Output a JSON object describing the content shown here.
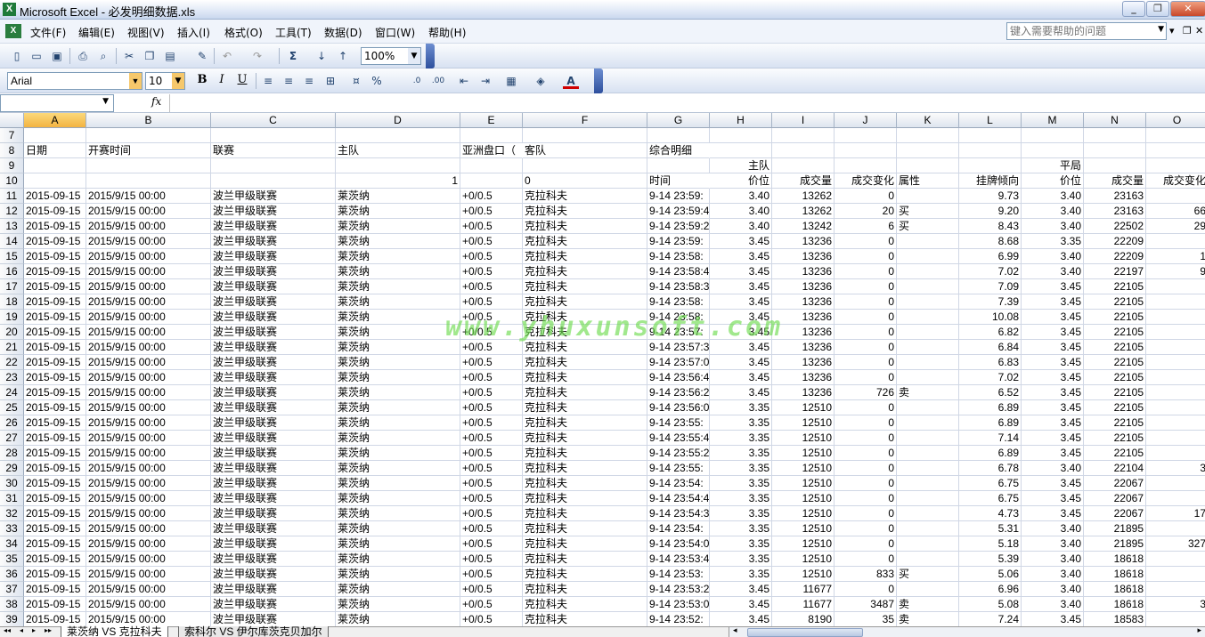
{
  "window": {
    "title": "Microsoft Excel - 必发明细数据.xls",
    "app_icon": "X",
    "minimize": "_",
    "restore": "❐",
    "close": "✕"
  },
  "menu": {
    "items": [
      "文件(F)",
      "编辑(E)",
      "视图(V)",
      "插入(I)",
      "格式(O)",
      "工具(T)",
      "数据(D)",
      "窗口(W)",
      "帮助(H)"
    ],
    "help_placeholder": "键入需要帮助的问题",
    "mdi_min": "▾",
    "mdi_restore": "❐",
    "mdi_close": "✕"
  },
  "toolbar": {
    "zoom": "100%",
    "font_name": "Arial",
    "font_size": "10",
    "bold": "B",
    "italic": "I",
    "underline": "U",
    "sum": "Σ",
    "percent": "%",
    "fx": "fx"
  },
  "namebox": "",
  "formula": "",
  "columns": [
    "A",
    "B",
    "C",
    "D",
    "E",
    "F",
    "G",
    "H",
    "I",
    "J",
    "K",
    "L",
    "M",
    "N",
    "O"
  ],
  "header_rows": [
    {
      "num": "7",
      "cells": {}
    },
    {
      "num": "8",
      "cells": {
        "A": "日期",
        "B": "开赛时间",
        "C": "联赛",
        "D": "主队",
        "E": "亚洲盘口（",
        "F": "客队",
        "G": "综合明细"
      }
    },
    {
      "num": "9",
      "cells": {
        "H": "主队",
        "M": "平局"
      }
    },
    {
      "num": "10",
      "cells": {
        "D": "1",
        "F": "0",
        "G": "时间",
        "H": "价位",
        "I": "成交量",
        "J": "成交变化",
        "K": "属性",
        "L": "挂牌倾向",
        "M": "价位",
        "N": "成交量",
        "O": "成交变化"
      }
    }
  ],
  "row_defaults": {
    "date": "2015-09-15",
    "start": "2015/9/15 00:00",
    "league": "波兰甲级联赛",
    "home": "莱茨纳",
    "handicap": "+0/0.5",
    "away": "克拉科夫"
  },
  "data_rows": [
    [
      "11",
      "9-14 23:59:",
      "3.40",
      "13262",
      "0",
      "",
      "9.73",
      "3.40",
      "23163",
      ""
    ],
    [
      "12",
      "9-14 23:59:4",
      "3.40",
      "13262",
      "20",
      "买",
      "9.20",
      "3.40",
      "23163",
      "66"
    ],
    [
      "13",
      "9-14 23:59:2",
      "3.40",
      "13242",
      "6",
      "买",
      "8.43",
      "3.40",
      "22502",
      "29"
    ],
    [
      "14",
      "9-14 23:59:",
      "3.45",
      "13236",
      "0",
      "",
      "8.68",
      "3.35",
      "22209",
      ""
    ],
    [
      "15",
      "9-14 23:58:",
      "3.45",
      "13236",
      "0",
      "",
      "6.99",
      "3.40",
      "22209",
      "1"
    ],
    [
      "16",
      "9-14 23:58:4",
      "3.45",
      "13236",
      "0",
      "",
      "7.02",
      "3.40",
      "22197",
      "9"
    ],
    [
      "17",
      "9-14 23:58:3",
      "3.45",
      "13236",
      "0",
      "",
      "7.09",
      "3.45",
      "22105",
      ""
    ],
    [
      "18",
      "9-14 23:58:",
      "3.45",
      "13236",
      "0",
      "",
      "7.39",
      "3.45",
      "22105",
      ""
    ],
    [
      "19",
      "9-14 23:58:",
      "3.45",
      "13236",
      "0",
      "",
      "10.08",
      "3.45",
      "22105",
      ""
    ],
    [
      "20",
      "9-14 23:57:",
      "3.45",
      "13236",
      "0",
      "",
      "6.82",
      "3.45",
      "22105",
      ""
    ],
    [
      "21",
      "9-14 23:57:3",
      "3.45",
      "13236",
      "0",
      "",
      "6.84",
      "3.45",
      "22105",
      ""
    ],
    [
      "22",
      "9-14 23:57:0",
      "3.45",
      "13236",
      "0",
      "",
      "6.83",
      "3.45",
      "22105",
      ""
    ],
    [
      "23",
      "9-14 23:56:4",
      "3.45",
      "13236",
      "0",
      "",
      "7.02",
      "3.45",
      "22105",
      ""
    ],
    [
      "24",
      "9-14 23:56:2",
      "3.45",
      "13236",
      "726",
      "卖",
      "6.52",
      "3.45",
      "22105",
      ""
    ],
    [
      "25",
      "9-14 23:56:0",
      "3.35",
      "12510",
      "0",
      "",
      "6.89",
      "3.45",
      "22105",
      ""
    ],
    [
      "26",
      "9-14 23:55:",
      "3.35",
      "12510",
      "0",
      "",
      "6.89",
      "3.45",
      "22105",
      ""
    ],
    [
      "27",
      "9-14 23:55:4",
      "3.35",
      "12510",
      "0",
      "",
      "7.14",
      "3.45",
      "22105",
      ""
    ],
    [
      "28",
      "9-14 23:55:2",
      "3.35",
      "12510",
      "0",
      "",
      "6.89",
      "3.45",
      "22105",
      ""
    ],
    [
      "29",
      "9-14 23:55:",
      "3.35",
      "12510",
      "0",
      "",
      "6.78",
      "3.40",
      "22104",
      "3"
    ],
    [
      "30",
      "9-14 23:54:",
      "3.35",
      "12510",
      "0",
      "",
      "6.75",
      "3.45",
      "22067",
      ""
    ],
    [
      "31",
      "9-14 23:54:4",
      "3.35",
      "12510",
      "0",
      "",
      "6.75",
      "3.45",
      "22067",
      ""
    ],
    [
      "32",
      "9-14 23:54:3",
      "3.35",
      "12510",
      "0",
      "",
      "4.73",
      "3.45",
      "22067",
      "17"
    ],
    [
      "33",
      "9-14 23:54:",
      "3.35",
      "12510",
      "0",
      "",
      "5.31",
      "3.40",
      "21895",
      ""
    ],
    [
      "34",
      "9-14 23:54:0",
      "3.35",
      "12510",
      "0",
      "",
      "5.18",
      "3.40",
      "21895",
      "327"
    ],
    [
      "35",
      "9-14 23:53:4",
      "3.35",
      "12510",
      "0",
      "",
      "5.39",
      "3.40",
      "18618",
      ""
    ],
    [
      "36",
      "9-14 23:53:",
      "3.35",
      "12510",
      "833",
      "买",
      "5.06",
      "3.40",
      "18618",
      ""
    ],
    [
      "37",
      "9-14 23:53:2",
      "3.45",
      "11677",
      "0",
      "",
      "6.96",
      "3.40",
      "18618",
      ""
    ],
    [
      "38",
      "9-14 23:53:0",
      "3.45",
      "11677",
      "3487",
      "卖",
      "5.08",
      "3.40",
      "18618",
      "3"
    ],
    [
      "39",
      "9-14 23:52:",
      "3.45",
      "8190",
      "35",
      "卖",
      "7.24",
      "3.45",
      "18583",
      ""
    ]
  ],
  "sheet_tabs": [
    "莱茨纳 VS 克拉科夫",
    "索科尔 VS 伊尔库茨克贝加尔"
  ],
  "tab_nav": [
    "◂◂",
    "◂",
    "▸",
    "▸▸"
  ],
  "watermark": "www.yhuxunsoft.com"
}
